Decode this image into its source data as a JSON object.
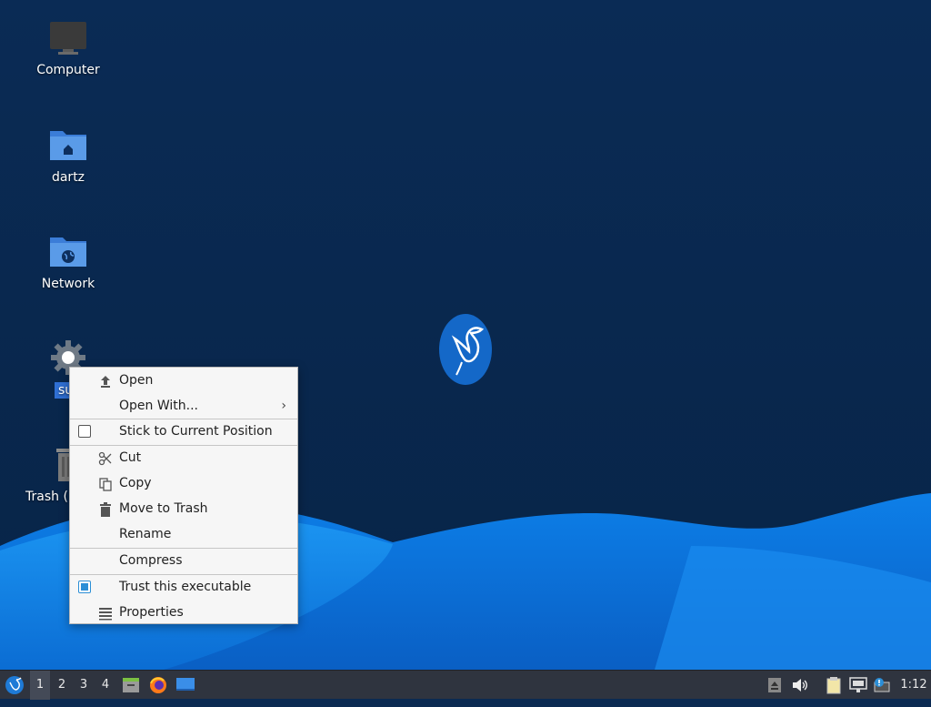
{
  "desktop_icons": [
    {
      "name": "computer",
      "label": "Computer"
    },
    {
      "name": "home",
      "label": "dartz"
    },
    {
      "name": "network",
      "label": "Network"
    },
    {
      "name": "settings-file",
      "label": "su"
    },
    {
      "name": "trash",
      "label": "Trash ("
    }
  ],
  "context_menu": {
    "items": [
      {
        "label": "Open",
        "icon": "upload-icon"
      },
      {
        "label": "Open With...",
        "submenu_arrow": "›"
      },
      {
        "label": "Stick to Current Position",
        "checked": false
      },
      {
        "label": "Cut",
        "icon": "scissors-icon"
      },
      {
        "label": "Copy",
        "icon": "copy-icon"
      },
      {
        "label": "Move to Trash",
        "icon": "trash-icon"
      },
      {
        "label": "Rename"
      },
      {
        "label": "Compress"
      },
      {
        "label": "Trust this executable",
        "checked": true
      },
      {
        "label": "Properties",
        "icon": "list-icon"
      }
    ]
  },
  "taskbar": {
    "workspaces": [
      "1",
      "2",
      "3",
      "4"
    ],
    "active_workspace": "1",
    "clock": "1:12"
  },
  "colors": {
    "wallpaper_dark": "#0b2a52",
    "wave_blue": "#1a8cf0",
    "menu_bg": "#f6f6f6",
    "taskbar_bg": "#2f343f",
    "selection": "#2f6fd3"
  }
}
